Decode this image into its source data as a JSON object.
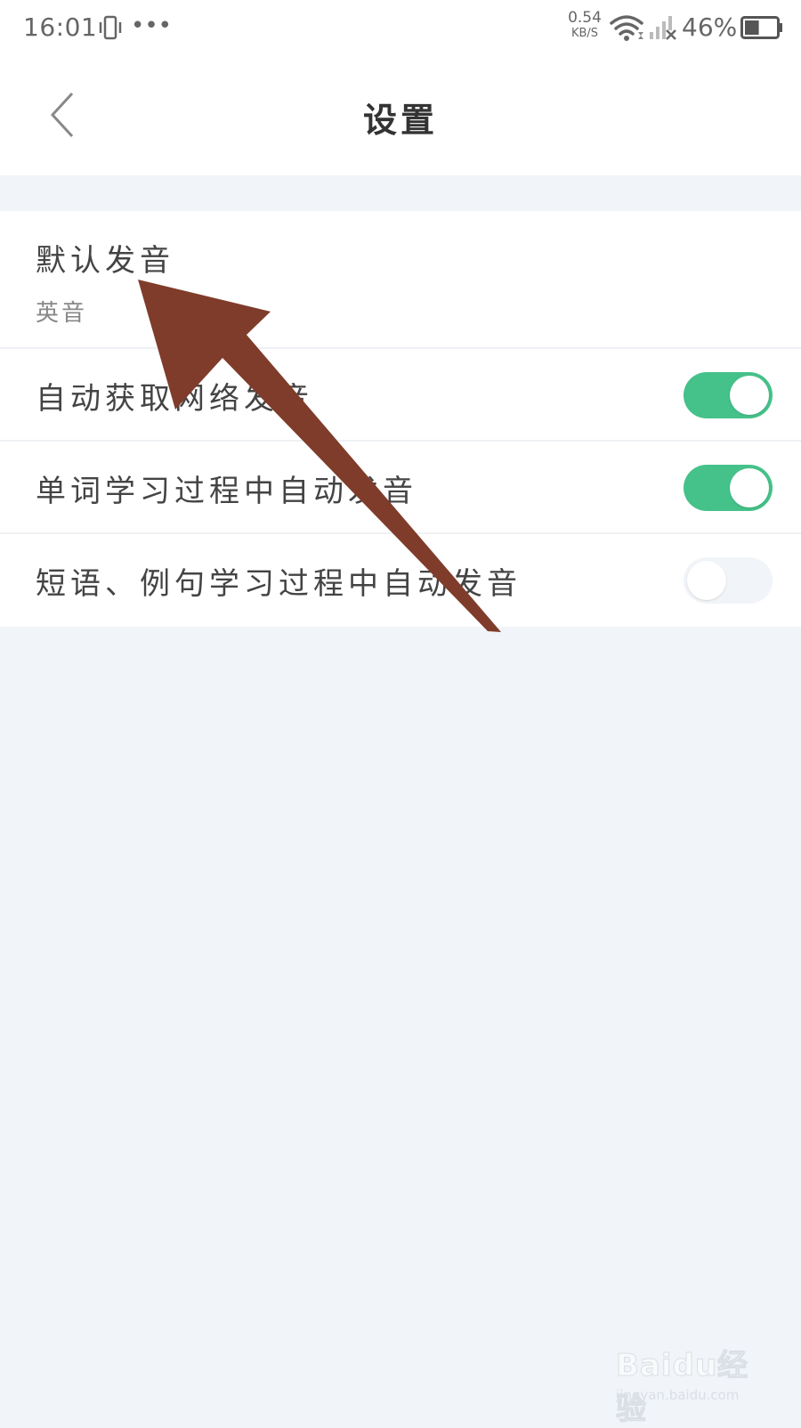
{
  "status_bar": {
    "time": "16:01",
    "more": "•••",
    "net_speed_value": "0.54",
    "net_speed_unit": "KB/S",
    "battery_percent": "46%",
    "battery_level": 0.46
  },
  "header": {
    "title": "设置"
  },
  "settings": {
    "default_pronunciation": {
      "label": "默认发音",
      "value": "英音"
    },
    "items": [
      {
        "label": "自动获取网络发音",
        "enabled": true
      },
      {
        "label": "单词学习过程中自动发音",
        "enabled": true
      },
      {
        "label": "短语、例句学习过程中自动发音",
        "enabled": false
      }
    ]
  },
  "colors": {
    "toggle_on": "#45c18a",
    "toggle_off": "#f1f4f8",
    "background": "#f1f4f8",
    "annotation_arrow": "#7f3c2a"
  },
  "watermark": {
    "brand": "Baidu经验",
    "url": "jingyan.baidu.com"
  }
}
